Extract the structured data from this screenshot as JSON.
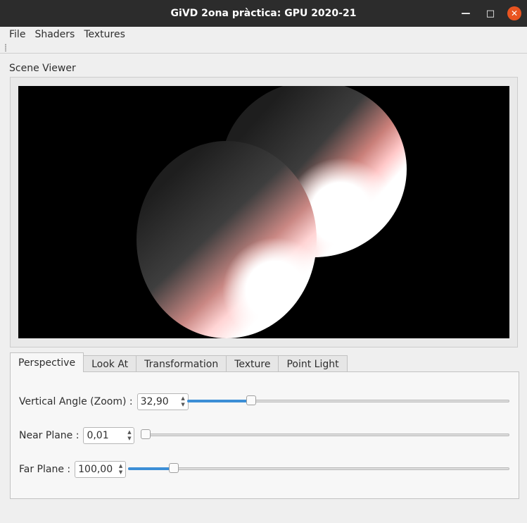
{
  "window": {
    "title": "GiVD 2ona pràctica: GPU 2020-21"
  },
  "menu": [
    "File",
    "Shaders",
    "Textures"
  ],
  "viewer": {
    "label": "Scene Viewer"
  },
  "tabs": [
    "Perspective",
    "Look At",
    "Transformation",
    "Texture",
    "Point Light"
  ],
  "active_tab": "Perspective",
  "perspective": {
    "vertical_angle": {
      "label": "Vertical Angle (Zoom) :",
      "value": "32,90",
      "slider_fraction": 0.19
    },
    "near_plane": {
      "label": "Near Plane :",
      "value": "0,01",
      "slider_fraction": 0.0
    },
    "far_plane": {
      "label": "Far Plane :",
      "value": "100,00",
      "slider_fraction": 0.11
    }
  },
  "colors": {
    "accent": "#3c8ed6",
    "close_button": "#e95420",
    "titlebar": "#2c2c2c"
  },
  "icons": {
    "minimize": "minimize-icon",
    "maximize": "maximize-icon",
    "close": "close-icon"
  }
}
